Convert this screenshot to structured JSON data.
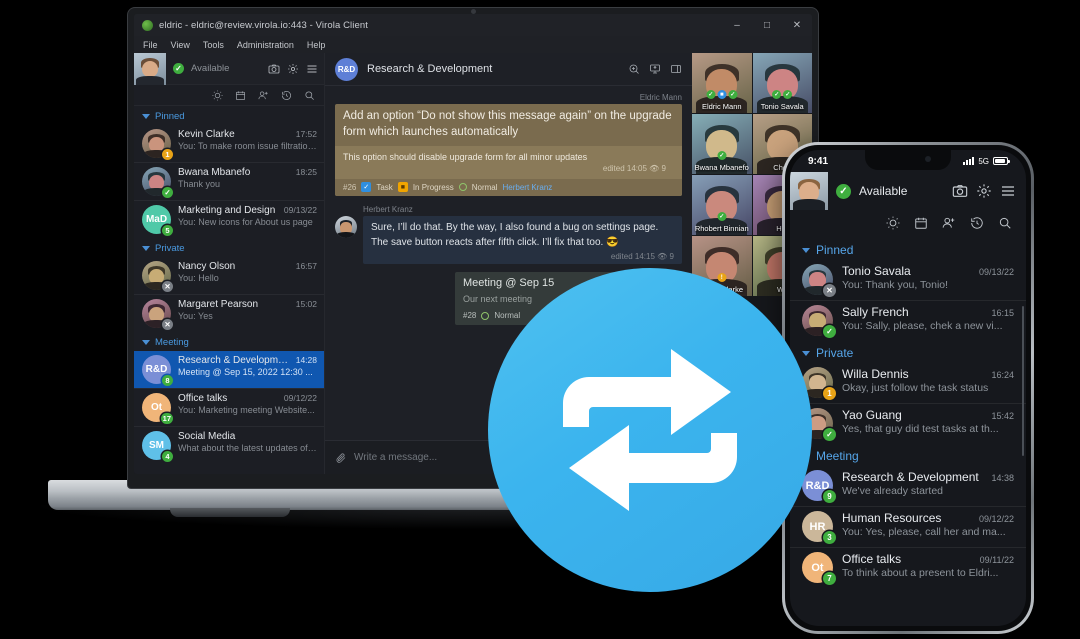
{
  "window": {
    "title": "eldric - eldric@review.virola.io:443 - Virola Client",
    "minimize": "–",
    "maximize": "□",
    "close": "✕",
    "menu": [
      "File",
      "View",
      "Tools",
      "Administration",
      "Help"
    ]
  },
  "account": {
    "status_label": "Available",
    "icons": [
      "camera-icon",
      "gear-icon",
      "hamburger-icon"
    ]
  },
  "sidebar": {
    "tool_icons": [
      "sun-icon",
      "calendar-icon",
      "add-contact-icon",
      "history-icon",
      "search-icon"
    ],
    "groups": [
      {
        "label": "Pinned",
        "items": [
          {
            "name": "Kevin Clarke",
            "time": "17:52",
            "preview": "You: To make room issue filtrations",
            "badge": "1",
            "badge_color": "amber",
            "avatar_type": "photo",
            "avatar_hue": 18
          },
          {
            "name": "Bwana Mbanefo",
            "time": "18:25",
            "preview": "Thank you",
            "badge": "✓",
            "badge_color": "green",
            "avatar_type": "photo",
            "avatar_hue": 200
          },
          {
            "name": "Marketing and Design",
            "time": "09/13/22",
            "preview": "You: New icons for About us page",
            "badge": "5",
            "badge_color": "green",
            "avatar_type": "initials",
            "initials": "MaD",
            "avatar_color": "#4fc9a8"
          }
        ]
      },
      {
        "label": "Private",
        "items": [
          {
            "name": "Nancy Olson",
            "time": "16:57",
            "preview": "You: Hello",
            "badge": "✕",
            "badge_color": "grey",
            "avatar_type": "photo",
            "avatar_hue": 40
          },
          {
            "name": "Margaret Pearson",
            "time": "15:02",
            "preview": "You: Yes",
            "badge": "✕",
            "badge_color": "grey",
            "avatar_type": "photo",
            "avatar_hue": 330
          }
        ]
      },
      {
        "label": "Meeting",
        "items": [
          {
            "name": "Research & Development",
            "time": "14:28",
            "preview": "Meeting @ Sep 15, 2022 12:30 ...",
            "badge": "8",
            "badge_color": "green",
            "avatar_type": "initials",
            "initials": "R&D",
            "avatar_color": "#7b8fd6",
            "selected": true
          },
          {
            "name": "Office talks",
            "time": "09/12/22",
            "preview": "You: Marketing meeting Website...",
            "badge": "17",
            "badge_color": "green",
            "avatar_type": "initials",
            "initials": "Ot",
            "avatar_color": "#f0b579"
          },
          {
            "name": "Social Media",
            "time": "",
            "preview": "What about the latest updates of ...",
            "badge": "4",
            "badge_color": "green",
            "avatar_type": "initials",
            "initials": "SM",
            "avatar_color": "#5fc0e8"
          }
        ]
      }
    ]
  },
  "chat": {
    "room_initials": "R&D",
    "room_title": "Research & Development",
    "header_icons": [
      "screenshot-icon",
      "screenshare-icon",
      "panel-icon"
    ],
    "task_message": {
      "author": "Eldric Mann",
      "title": "Add an option “Do not show this message again” on the upgrade form which launches automatically",
      "body": "This option should disable upgrade form for all minor updates",
      "meta": "edited 14:05",
      "views": "9",
      "id": "#26",
      "type_label": "Task",
      "state_label": "In Progress",
      "priority_label": "Normal",
      "assignee": "Herbert Kranz"
    },
    "reply_message": {
      "author": "Herbert Kranz",
      "text": "Sure, I’ll do that. By the way, I also found a bug on settings page. The save button reacts after fifth click. I’ll fix that too. 😎",
      "meta": "edited 14:15",
      "views": "9"
    },
    "meeting_card": {
      "title": "Meeting @ Sep 15",
      "body": "Our next meeting",
      "id": "#28",
      "priority_label": "Normal"
    },
    "composer_placeholder": "Write a message..."
  },
  "contacts": [
    {
      "name": "Eldric Mann",
      "badges": [
        "green",
        "blue",
        "green"
      ],
      "hue": 24
    },
    {
      "name": "Tonio Savala",
      "badges": [
        "green",
        "green"
      ],
      "hue": 200
    },
    {
      "name": "Bwana Mbanefo",
      "badges": [
        "green"
      ],
      "hue": 190
    },
    {
      "name": "Chen",
      "badges": [],
      "hue": 30
    },
    {
      "name": "Rhobert Binnian",
      "badges": [
        "green"
      ],
      "hue": 210
    },
    {
      "name": "Her",
      "badges": [],
      "hue": 280
    },
    {
      "name": "Kevin Clarke",
      "badges": [
        "amber"
      ],
      "hue": 15
    },
    {
      "name": "Wil",
      "badges": [],
      "hue": 60
    }
  ],
  "phone": {
    "status": {
      "time": "9:41",
      "network": "5G"
    },
    "account": {
      "status_label": "Available",
      "icons": [
        "camera-icon",
        "gear-icon",
        "hamburger-icon"
      ]
    },
    "tool_icons": [
      "sun-icon",
      "calendar-icon",
      "add-contact-icon",
      "history-icon",
      "search-icon"
    ],
    "groups": [
      {
        "label": "Pinned",
        "items": [
          {
            "name": "Tonio Savala",
            "time": "09/13/22",
            "preview": "You: Thank you, Tonio!",
            "badge": "✕",
            "badge_color": "grey",
            "avatar_type": "photo",
            "avatar_hue": 200
          },
          {
            "name": "Sally French",
            "time": "16:15",
            "preview": "You: Sally, please, chek a new vi...",
            "badge": "✓",
            "badge_color": "green",
            "avatar_type": "photo",
            "avatar_hue": 340
          }
        ]
      },
      {
        "label": "Private",
        "items": [
          {
            "name": "Willa Dennis",
            "time": "16:24",
            "preview": "Okay, just follow the task status",
            "badge": "1",
            "badge_color": "amber",
            "avatar_type": "photo",
            "avatar_hue": 35
          },
          {
            "name": "Yao Guang",
            "time": "15:42",
            "preview": "Yes, that guy did test tasks at th...",
            "badge": "✓",
            "badge_color": "green",
            "avatar_type": "photo",
            "avatar_hue": 20
          }
        ]
      },
      {
        "label": "Meeting",
        "items": [
          {
            "name": "Research & Development",
            "time": "14:38",
            "preview": "We've already started",
            "badge": "9",
            "badge_color": "green",
            "avatar_type": "initials",
            "initials": "R&D",
            "avatar_color": "#7b8fd6"
          },
          {
            "name": "Human Resources",
            "time": "09/12/22",
            "preview": "You: Yes, please, call her and ma...",
            "badge": "3",
            "badge_color": "green",
            "avatar_type": "initials",
            "initials": "HR",
            "avatar_color": "#cbb79a"
          },
          {
            "name": "Office talks",
            "time": "09/11/22",
            "preview": "To think about a present to Eldri...",
            "badge": "7",
            "badge_color": "green",
            "avatar_type": "initials",
            "initials": "Ot",
            "avatar_color": "#f0b579"
          }
        ]
      }
    ]
  },
  "sync_badge": {
    "icon": "sync-arrows-icon",
    "color": "#3bb4ee"
  },
  "colors": {
    "accent": "#3bb4ee",
    "selected": "#1057b0",
    "online": "#3fae3f",
    "away": "#e8a317"
  }
}
